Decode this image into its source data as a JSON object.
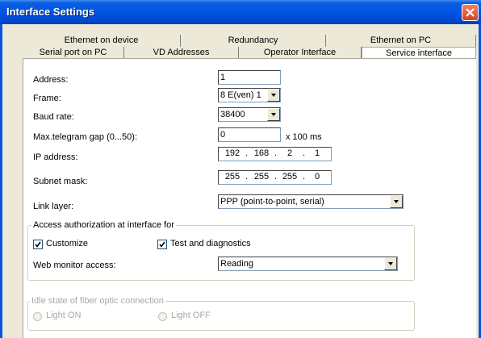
{
  "window": {
    "title": "Interface Settings"
  },
  "tabs": {
    "row1": [
      "Ethernet on device",
      "Redundancy",
      "Ethernet on PC"
    ],
    "row2": [
      "Serial port on PC",
      "VD Addresses",
      "Operator Interface",
      "Service interface"
    ],
    "active": "Service interface"
  },
  "form": {
    "address": {
      "label": "Address:",
      "value": "1"
    },
    "frame": {
      "label": "Frame:",
      "value": "8 E(ven) 1"
    },
    "baud": {
      "label": "Baud rate:",
      "value": "38400"
    },
    "gap": {
      "label": "Max.telegram gap (0...50):",
      "value": "0",
      "unit": "x 100 ms"
    },
    "ip": {
      "label": "IP address:",
      "octets": [
        "192",
        "168",
        "2",
        "1"
      ]
    },
    "subnet": {
      "label": "Subnet mask:",
      "octets": [
        "255",
        "255",
        "255",
        "0"
      ]
    },
    "link": {
      "label": "Link layer:",
      "value": "PPP (point-to-point, serial)"
    }
  },
  "access": {
    "legend": "Access authorization at interface for",
    "customize": {
      "label": "Customize",
      "checked": true
    },
    "test": {
      "label": "Test and diagnostics",
      "checked": true
    },
    "web": {
      "label": "Web monitor access:",
      "value": "Reading"
    }
  },
  "idle": {
    "legend": "Idle state of fiber optic connection",
    "light_on": "Light ON",
    "light_off": "Light OFF"
  }
}
